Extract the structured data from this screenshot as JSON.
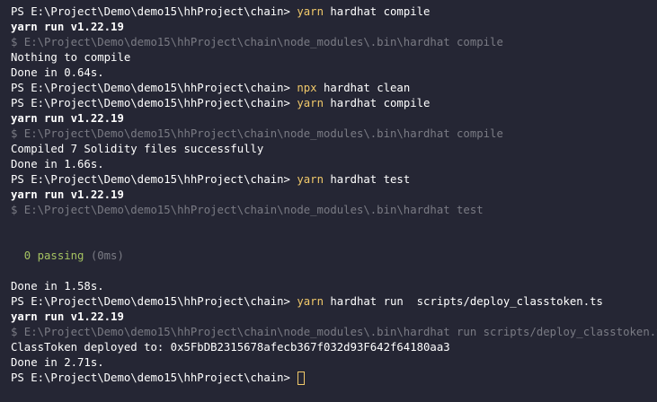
{
  "terminal": {
    "prompt": "PS E:\\Project\\Demo\\demo15\\hhProject\\chain> ",
    "lines": [
      {
        "type": "prompt",
        "cmd": "yarn",
        "args": " hardhat compile"
      },
      {
        "type": "bold",
        "text": "yarn run v1.22.19"
      },
      {
        "type": "dim",
        "text": "$ E:\\Project\\Demo\\demo15\\hhProject\\chain\\node_modules\\.bin\\hardhat compile"
      },
      {
        "type": "out",
        "text": "Nothing to compile"
      },
      {
        "type": "out",
        "text": "Done in 0.64s."
      },
      {
        "type": "prompt",
        "cmd": "npx",
        "args": " hardhat clean"
      },
      {
        "type": "prompt",
        "cmd": "yarn",
        "args": " hardhat compile"
      },
      {
        "type": "bold",
        "text": "yarn run v1.22.19"
      },
      {
        "type": "dim",
        "text": "$ E:\\Project\\Demo\\demo15\\hhProject\\chain\\node_modules\\.bin\\hardhat compile"
      },
      {
        "type": "out",
        "text": "Compiled 7 Solidity files successfully"
      },
      {
        "type": "out",
        "text": "Done in 1.66s."
      },
      {
        "type": "prompt",
        "cmd": "yarn",
        "args": " hardhat test"
      },
      {
        "type": "bold",
        "text": "yarn run v1.22.19"
      },
      {
        "type": "dim",
        "text": "$ E:\\Project\\Demo\\demo15\\hhProject\\chain\\node_modules\\.bin\\hardhat test"
      },
      {
        "type": "blank"
      },
      {
        "type": "blank"
      },
      {
        "type": "passing",
        "text": "  0 passing",
        "time": " (0ms)"
      },
      {
        "type": "blank"
      },
      {
        "type": "out",
        "text": "Done in 1.58s."
      },
      {
        "type": "prompt",
        "cmd": "yarn",
        "args": " hardhat run  scripts/deploy_classtoken.ts"
      },
      {
        "type": "bold",
        "text": "yarn run v1.22.19"
      },
      {
        "type": "dim",
        "text": "$ E:\\Project\\Demo\\demo15\\hhProject\\chain\\node_modules\\.bin\\hardhat run scripts/deploy_classtoken.ts"
      },
      {
        "type": "out",
        "text": "ClassToken deployed to: 0x5FbDB2315678afecb367f032d93F642f64180aa3"
      },
      {
        "type": "out",
        "text": "Done in 2.71s."
      },
      {
        "type": "cursor"
      }
    ],
    "colors": {
      "background": "#252634",
      "command": "#f1c96a",
      "dim": "#7a7b84",
      "passing": "#a5c261"
    }
  }
}
